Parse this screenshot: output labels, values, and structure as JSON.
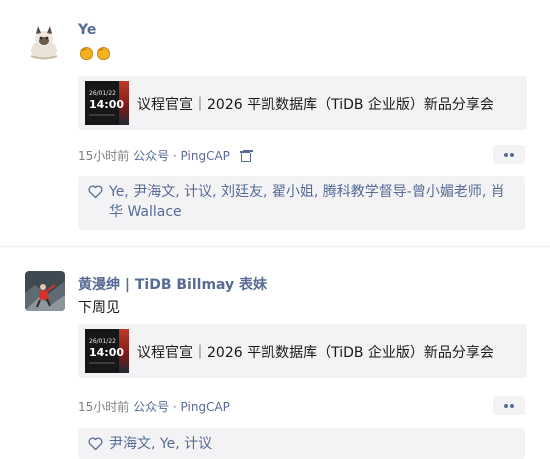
{
  "posts": [
    {
      "author": "Ye",
      "avatar_icon": "cat-avatar",
      "content_emoji": [
        "clapping-hands",
        "clapping-hands"
      ],
      "card": {
        "thumb_date": "26/01/22",
        "thumb_time": "14:00",
        "title": "议程官宣｜2026 平凯数据库（TiDB 企业版）新品分享会"
      },
      "meta": {
        "time": "15小时前",
        "source": "公众号 · PingCAP"
      },
      "likes": "Ye, 尹海文, 计议, 刘廷友, 翟小姐, 腾科教学督导-曾小媚老师, 肖华 Wallace"
    },
    {
      "author": "黄漫绅 | TiDB Billmay 表妹",
      "avatar_icon": "climber-photo-avatar",
      "content": "下周见",
      "card": {
        "thumb_date": "26/01/22",
        "thumb_time": "14:00",
        "title": "议程官宣｜2026 平凯数据库（TiDB 企业版）新品分享会"
      },
      "meta": {
        "time": "15小时前",
        "source": "公众号 · PingCAP"
      },
      "likes": "尹海文, Ye, 计议"
    }
  ],
  "colors": {
    "link": "#576b95",
    "card_bg": "#f3f3f5",
    "meta": "#7f7f7f",
    "text": "#191919"
  }
}
